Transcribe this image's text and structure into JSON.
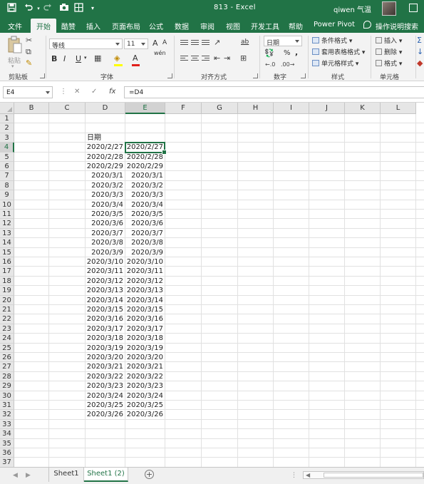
{
  "titlebar": {
    "title": "813  -  Excel",
    "user": "qiwen 气温",
    "icons": [
      "save-icon",
      "undo-icon",
      "redo-icon",
      "camera-icon",
      "form-icon",
      "customize-toolbar-icon"
    ]
  },
  "tabs": [
    "文件",
    "开始",
    "酷赞",
    "插入",
    "页面布局",
    "公式",
    "数据",
    "审阅",
    "视图",
    "开发工具",
    "帮助",
    "Power Pivot",
    "操作说明搜索"
  ],
  "ribbon": {
    "clipboard": {
      "paste": "粘贴",
      "label": "剪贴板"
    },
    "font": {
      "name": "等线",
      "size": "11",
      "bold": "B",
      "italic": "I",
      "underline": "U",
      "grow": "A",
      "shrink": "A",
      "wen": "wén",
      "label": "字体"
    },
    "alignment": {
      "label": "对齐方式",
      "wrap": "ab"
    },
    "number": {
      "format": "日期",
      "percent": "%",
      "comma": ",",
      "label": "数字"
    },
    "styles": {
      "conditional": "条件格式",
      "table": "套用表格格式",
      "cell": "单元格样式",
      "label": "样式"
    },
    "cells": {
      "insert": "插入",
      "delete": "删除",
      "format": "格式",
      "label": "单元格"
    }
  },
  "formula_bar": {
    "name_box": "E4",
    "formula": "=D4",
    "fx": "fx"
  },
  "grid": {
    "columns": [
      "B",
      "C",
      "D",
      "E",
      "F",
      "G",
      "H",
      "I",
      "J",
      "K",
      "L"
    ],
    "rows": [
      "1",
      "2",
      "3",
      "4",
      "5",
      "6",
      "7",
      "8",
      "9",
      "10",
      "11",
      "12",
      "13",
      "14",
      "15",
      "16",
      "17",
      "18",
      "19",
      "20",
      "21",
      "22",
      "23",
      "24",
      "25",
      "26",
      "27",
      "28",
      "29",
      "30",
      "31",
      "32",
      "33",
      "34",
      "35",
      "36",
      "37"
    ],
    "selected_cell": "E4",
    "header_d3": "日期",
    "dates": [
      "2020/2/27",
      "2020/2/28",
      "2020/2/29",
      "2020/3/1",
      "2020/3/2",
      "2020/3/3",
      "2020/3/4",
      "2020/3/5",
      "2020/3/6",
      "2020/3/7",
      "2020/3/8",
      "2020/3/9",
      "2020/3/10",
      "2020/3/11",
      "2020/3/12",
      "2020/3/13",
      "2020/3/14",
      "2020/3/15",
      "2020/3/16",
      "2020/3/17",
      "2020/3/18",
      "2020/3/19",
      "2020/3/20",
      "2020/3/21",
      "2020/3/22",
      "2020/3/23",
      "2020/3/24",
      "2020/3/25",
      "2020/3/26"
    ]
  },
  "sheets": [
    "Sheet1",
    "Sheet1 (2)"
  ],
  "active_sheet": "Sheet1 (2)",
  "colors": {
    "accent": "#217346",
    "ribbon_bg": "#f3f3f3",
    "header_bg": "#e6e6e6"
  }
}
